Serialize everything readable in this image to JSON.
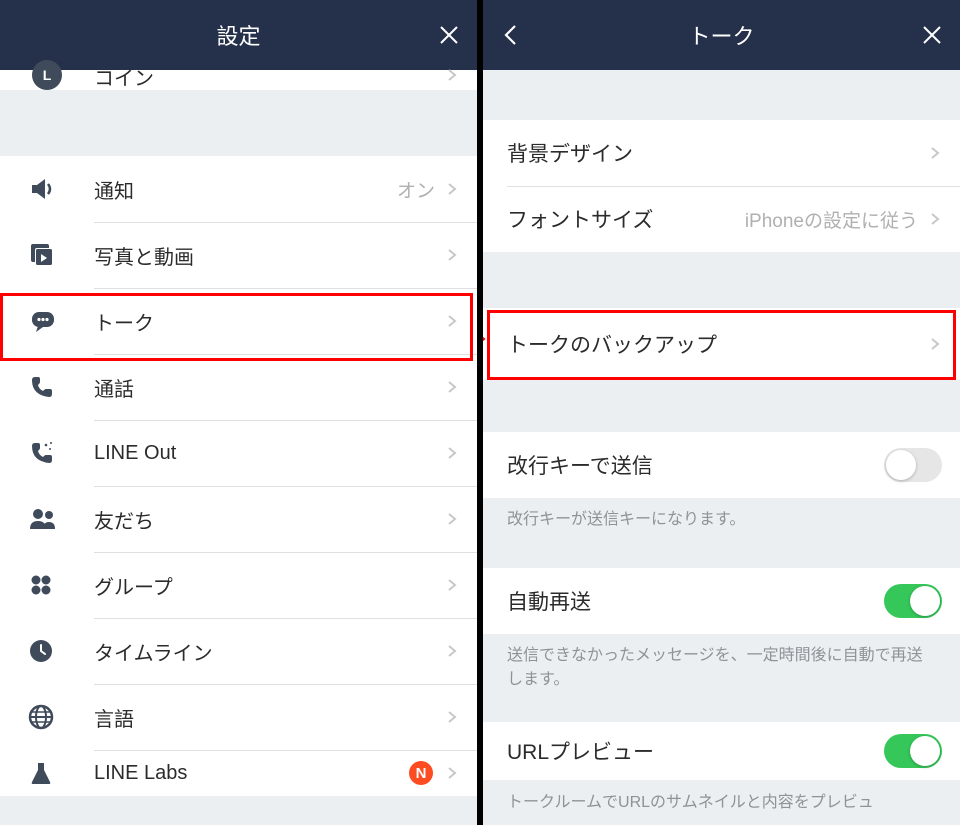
{
  "left": {
    "title": "設定",
    "partial_top_label": "コイン",
    "items": [
      {
        "label": "通知",
        "value": "オン",
        "icon": "speaker"
      },
      {
        "label": "写真と動画",
        "icon": "photo"
      },
      {
        "label": "トーク",
        "icon": "chat",
        "highlighted": true
      },
      {
        "label": "通話",
        "icon": "phone"
      },
      {
        "label": "LINE Out",
        "icon": "phone-sparkle"
      },
      {
        "label": "友だち",
        "icon": "friends"
      },
      {
        "label": "グループ",
        "icon": "group"
      },
      {
        "label": "タイムライン",
        "icon": "clock"
      },
      {
        "label": "言語",
        "icon": "globe"
      },
      {
        "label": "LINE Labs",
        "icon": "flask",
        "badge": "N"
      }
    ]
  },
  "right": {
    "title": "トーク",
    "sections": {
      "design": [
        {
          "label": "背景デザイン"
        },
        {
          "label": "フォントサイズ",
          "value": "iPhoneの設定に従う"
        }
      ],
      "backup": [
        {
          "label": "トークのバックアップ",
          "highlighted": true
        }
      ],
      "send": {
        "row": {
          "label": "改行キーで送信",
          "toggle": false
        },
        "note": "改行キーが送信キーになります。"
      },
      "resend": {
        "row": {
          "label": "自動再送",
          "toggle": true
        },
        "note": "送信できなかったメッセージを、一定時間後に自動で再送します。"
      },
      "url": {
        "row": {
          "label": "URLプレビュー",
          "toggle": true
        },
        "note_partial": "トークルームでURLのサムネイルと内容をプレビュ"
      }
    }
  }
}
